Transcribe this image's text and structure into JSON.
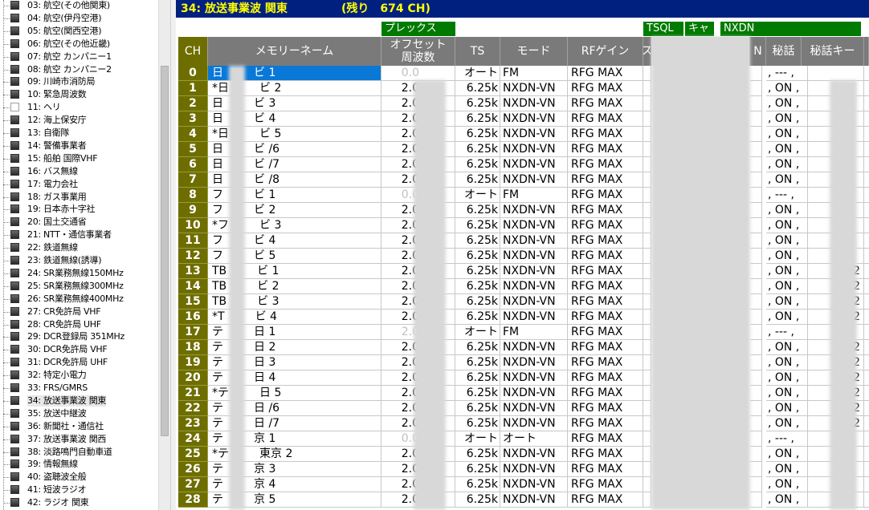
{
  "tree": {
    "items": [
      {
        "label": "03: 航空(その他関東)",
        "icon": "channel-group-icon"
      },
      {
        "label": "04: 航空(伊丹空港)",
        "icon": "channel-group-icon"
      },
      {
        "label": "05: 航空(関西空港)",
        "icon": "channel-group-icon"
      },
      {
        "label": "06: 航空(その他近畿)",
        "icon": "channel-group-icon"
      },
      {
        "label": "07: 航空 カンパニー1",
        "icon": "channel-group-icon"
      },
      {
        "label": "08: 航空 カンパニー2",
        "icon": "channel-group-icon"
      },
      {
        "label": "09: 川崎市消防局",
        "icon": "channel-group-icon"
      },
      {
        "label": "10: 緊急周波数",
        "icon": "channel-group-icon"
      },
      {
        "label": "11: ヘリ",
        "icon": "empty-group-icon"
      },
      {
        "label": "12: 海上保安庁",
        "icon": "channel-group-icon"
      },
      {
        "label": "13: 自衛隊",
        "icon": "channel-group-icon"
      },
      {
        "label": "14: 警備事業者",
        "icon": "channel-group-icon"
      },
      {
        "label": "15: 船舶 国際VHF",
        "icon": "channel-group-icon"
      },
      {
        "label": "16: バス無線",
        "icon": "channel-group-icon"
      },
      {
        "label": "17: 電力会社",
        "icon": "channel-group-icon"
      },
      {
        "label": "18: ガス事業用",
        "icon": "channel-group-icon"
      },
      {
        "label": "19: 日本赤十字社",
        "icon": "channel-group-icon"
      },
      {
        "label": "20: 国土交通省",
        "icon": "channel-group-icon"
      },
      {
        "label": "21: NTT・通信事業者",
        "icon": "channel-group-icon"
      },
      {
        "label": "22: 鉄道無線",
        "icon": "channel-group-icon"
      },
      {
        "label": "23: 鉄道無線(誘導)",
        "icon": "channel-group-icon"
      },
      {
        "label": "24: SR業務無線150MHz",
        "icon": "channel-group-icon"
      },
      {
        "label": "25: SR業務無線300MHz",
        "icon": "channel-group-icon"
      },
      {
        "label": "26: SR業務無線400MHz",
        "icon": "channel-group-icon"
      },
      {
        "label": "27: CR免許局 VHF",
        "icon": "channel-group-icon"
      },
      {
        "label": "28: CR免許局 UHF",
        "icon": "channel-group-icon"
      },
      {
        "label": "29: DCR登録局 351MHz",
        "icon": "channel-group-icon"
      },
      {
        "label": "30: DCR免許局 VHF",
        "icon": "channel-group-icon"
      },
      {
        "label": "31: DCR免許局 UHF",
        "icon": "channel-group-icon"
      },
      {
        "label": "32: 特定小電力",
        "icon": "channel-group-icon"
      },
      {
        "label": "33: FRS/GMRS",
        "icon": "channel-group-icon"
      },
      {
        "label": "34: 放送事業波 関東",
        "icon": "channel-group-icon",
        "selected": true
      },
      {
        "label": "35: 放送中継波",
        "icon": "channel-group-icon"
      },
      {
        "label": "36: 新聞社・通信社",
        "icon": "channel-group-icon"
      },
      {
        "label": "37: 放送事業波 関西",
        "icon": "channel-group-icon"
      },
      {
        "label": "38: 淡路鳴門自動車道",
        "icon": "channel-group-icon"
      },
      {
        "label": "39: 情報無線",
        "icon": "channel-group-icon"
      },
      {
        "label": "40: 盗聴波全般",
        "icon": "channel-group-icon"
      },
      {
        "label": "41: 短波ラジオ",
        "icon": "channel-group-icon"
      },
      {
        "label": "42: ラジオ 関東",
        "icon": "channel-group-icon"
      }
    ]
  },
  "header": {
    "title": "34: 放送事業波 関東",
    "remaining": "(残り　674 CH)"
  },
  "groups": {
    "duplex": "プレックス",
    "tsql": "TSQL",
    "key": "キャ",
    "nxdn": "NXDN"
  },
  "columns": {
    "ch": "CH",
    "name": "メモリーネーム",
    "offset": "オフセット\n周波数",
    "ts": "TS",
    "mode": "モード",
    "rfgain": "RFゲイン",
    "x": "ス",
    "n": "N",
    "secret": "秘話",
    "secretkey": "秘話キー"
  },
  "rows": [
    {
      "ch": "0",
      "name": "日",
      "name2": "ビ 1",
      "offset": "0.0",
      "ts": "オート",
      "mode": "FM",
      "rfg": "RFG MAX",
      "on": "---",
      "key": "",
      "fm": true,
      "sel": true
    },
    {
      "ch": "1",
      "name": "*日",
      "name2": "ビ 2",
      "offset": "2.0",
      "ts": "6.25k",
      "mode": "NXDN-VN",
      "rfg": "RFG MAX",
      "on": "ON",
      "key": ""
    },
    {
      "ch": "2",
      "name": "日",
      "name2": "ビ 3",
      "offset": "2.0",
      "ts": "6.25k",
      "mode": "NXDN-VN",
      "rfg": "RFG MAX",
      "on": "ON",
      "key": ""
    },
    {
      "ch": "3",
      "name": "日",
      "name2": "ビ 4",
      "offset": "2.0",
      "ts": "6.25k",
      "mode": "NXDN-VN",
      "rfg": "RFG MAX",
      "on": "ON",
      "key": ""
    },
    {
      "ch": "4",
      "name": "*日",
      "name2": "ビ 5",
      "offset": "2.0",
      "ts": "6.25k",
      "mode": "NXDN-VN",
      "rfg": "RFG MAX",
      "on": "ON",
      "key": ""
    },
    {
      "ch": "5",
      "name": "日",
      "name2": "ビ /6",
      "offset": "2.0",
      "ts": "6.25k",
      "mode": "NXDN-VN",
      "rfg": "RFG MAX",
      "on": "ON",
      "key": ""
    },
    {
      "ch": "6",
      "name": "日",
      "name2": "ビ /7",
      "offset": "2.0",
      "ts": "6.25k",
      "mode": "NXDN-VN",
      "rfg": "RFG MAX",
      "on": "ON",
      "key": ""
    },
    {
      "ch": "7",
      "name": "日",
      "name2": "ビ /8",
      "offset": "2.0",
      "ts": "6.25k",
      "mode": "NXDN-VN",
      "rfg": "RFG MAX",
      "on": "ON",
      "key": ""
    },
    {
      "ch": "8",
      "name": "フ",
      "name2": "ビ 1",
      "offset": "0.0",
      "ts": "オート",
      "mode": "FM",
      "rfg": "RFG MAX",
      "on": "---",
      "key": "",
      "fm": true
    },
    {
      "ch": "9",
      "name": "フ",
      "name2": "ビ 2",
      "offset": "2.0",
      "ts": "6.25k",
      "mode": "NXDN-VN",
      "rfg": "RFG MAX",
      "on": "ON",
      "key": ""
    },
    {
      "ch": "10",
      "name": "*フ",
      "name2": "ビ 3",
      "offset": "2.0",
      "ts": "6.25k",
      "mode": "NXDN-VN",
      "rfg": "RFG MAX",
      "on": "ON",
      "key": ""
    },
    {
      "ch": "11",
      "name": "フ",
      "name2": "ビ 4",
      "offset": "2.0",
      "ts": "6.25k",
      "mode": "NXDN-VN",
      "rfg": "RFG MAX",
      "on": "ON",
      "key": ""
    },
    {
      "ch": "12",
      "name": "フ",
      "name2": "ビ 5",
      "offset": "2.0",
      "ts": "6.25k",
      "mode": "NXDN-VN",
      "rfg": "RFG MAX",
      "on": "ON",
      "key": ""
    },
    {
      "ch": "13",
      "name": "TB",
      "name2": "ビ 1",
      "offset": "2.0",
      "ts": "6.25k",
      "mode": "NXDN-VN",
      "rfg": "RFG MAX",
      "on": "ON",
      "key": "2"
    },
    {
      "ch": "14",
      "name": "TB",
      "name2": "ビ 2",
      "offset": "2.0",
      "ts": "6.25k",
      "mode": "NXDN-VN",
      "rfg": "RFG MAX",
      "on": "ON",
      "key": "2"
    },
    {
      "ch": "15",
      "name": "TB",
      "name2": "ビ 3",
      "offset": "2.0",
      "ts": "6.25k",
      "mode": "NXDN-VN",
      "rfg": "RFG MAX",
      "on": "ON",
      "key": "2"
    },
    {
      "ch": "16",
      "name": "*T",
      "name2": "ビ 4",
      "offset": "2.0",
      "ts": "6.25k",
      "mode": "NXDN-VN",
      "rfg": "RFG MAX",
      "on": "ON",
      "key": "2"
    },
    {
      "ch": "17",
      "name": "テ",
      "name2": "日 1",
      "offset": "2.0",
      "ts": "オート",
      "mode": "FM",
      "rfg": "RFG MAX",
      "on": "---",
      "key": "",
      "fm": true
    },
    {
      "ch": "18",
      "name": "テ",
      "name2": "日 2",
      "offset": "2.0",
      "ts": "6.25k",
      "mode": "NXDN-VN",
      "rfg": "RFG MAX",
      "on": "ON",
      "key": "2"
    },
    {
      "ch": "19",
      "name": "テ",
      "name2": "日 3",
      "offset": "2.0",
      "ts": "6.25k",
      "mode": "NXDN-VN",
      "rfg": "RFG MAX",
      "on": "ON",
      "key": "2"
    },
    {
      "ch": "20",
      "name": "テ",
      "name2": "日 4",
      "offset": "2.0",
      "ts": "6.25k",
      "mode": "NXDN-VN",
      "rfg": "RFG MAX",
      "on": "ON",
      "key": "2"
    },
    {
      "ch": "21",
      "name": "*テ",
      "name2": "日 5",
      "offset": "2.0",
      "ts": "6.25k",
      "mode": "NXDN-VN",
      "rfg": "RFG MAX",
      "on": "ON",
      "key": "2"
    },
    {
      "ch": "22",
      "name": "テ",
      "name2": "日 /6",
      "offset": "2.0",
      "ts": "6.25k",
      "mode": "NXDN-VN",
      "rfg": "RFG MAX",
      "on": "ON",
      "key": "2"
    },
    {
      "ch": "23",
      "name": "テ",
      "name2": "日 /7",
      "offset": "2.0",
      "ts": "6.25k",
      "mode": "NXDN-VN",
      "rfg": "RFG MAX",
      "on": "ON",
      "key": "2"
    },
    {
      "ch": "24",
      "name": "テ",
      "name2": "京 1",
      "offset": "0.0",
      "ts": "オート",
      "mode": "オート",
      "rfg": "RFG MAX",
      "on": "---",
      "key": "",
      "fm": true
    },
    {
      "ch": "25",
      "name": "*テ",
      "name2": "東京 2",
      "offset": "2.0",
      "ts": "6.25k",
      "mode": "NXDN-VN",
      "rfg": "RFG MAX",
      "on": "ON",
      "key": ""
    },
    {
      "ch": "26",
      "name": "テ",
      "name2": "京 3",
      "offset": "2.0",
      "ts": "6.25k",
      "mode": "NXDN-VN",
      "rfg": "RFG MAX",
      "on": "ON",
      "key": ""
    },
    {
      "ch": "27",
      "name": "テ",
      "name2": "京 4",
      "offset": "2.0",
      "ts": "6.25k",
      "mode": "NXDN-VN",
      "rfg": "RFG MAX",
      "on": "ON",
      "key": ""
    },
    {
      "ch": "28",
      "name": "テ",
      "name2": "京 5",
      "offset": "2.0",
      "ts": "6.25k",
      "mode": "NXDN-VN",
      "rfg": "RFG MAX",
      "on": "ON",
      "key": ""
    }
  ]
}
